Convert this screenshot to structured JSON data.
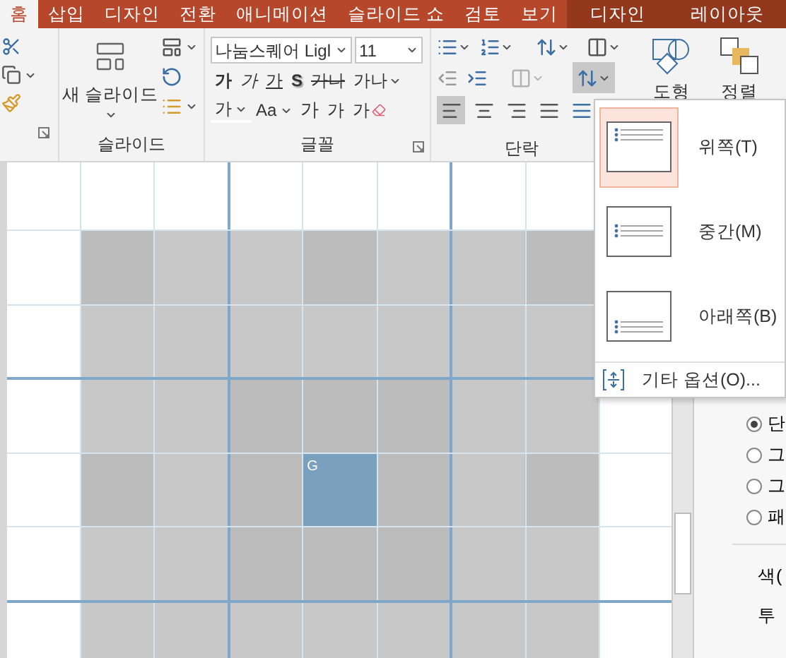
{
  "tabs": [
    {
      "label": "홈",
      "selected": true,
      "contextual": false
    },
    {
      "label": "삽입",
      "selected": false,
      "contextual": false
    },
    {
      "label": "디자인",
      "selected": false,
      "contextual": false
    },
    {
      "label": "전환",
      "selected": false,
      "contextual": false
    },
    {
      "label": "애니메이션",
      "selected": false,
      "contextual": false
    },
    {
      "label": "슬라이드 쇼",
      "selected": false,
      "contextual": false
    },
    {
      "label": "검토",
      "selected": false,
      "contextual": false
    },
    {
      "label": "보기",
      "selected": false,
      "contextual": false
    },
    {
      "label": "디자인",
      "selected": false,
      "contextual": true
    },
    {
      "label": "레이아웃",
      "selected": false,
      "contextual": true
    }
  ],
  "ribbon": {
    "slides_group": {
      "label": "슬라이드",
      "new_slide": "새 슬라이드"
    },
    "font_group": {
      "label": "글꼴",
      "font_name": "나눔스퀘어 Ligl",
      "font_size": "11",
      "row_2": [
        {
          "kind": "bold",
          "text": "가"
        },
        {
          "kind": "italic",
          "text": "가"
        },
        {
          "kind": "underline",
          "text": "가"
        },
        {
          "kind": "shadow",
          "text": "S"
        },
        {
          "kind": "strike",
          "text": "가나"
        },
        {
          "kind": "spacing",
          "text": "가나"
        }
      ],
      "row_3": [
        {
          "kind": "color",
          "text": "가"
        },
        {
          "kind": "case",
          "text": "Aa"
        },
        {
          "kind": "grow",
          "text": "가"
        },
        {
          "kind": "shrink",
          "text": "가"
        },
        {
          "kind": "clear",
          "text": "가"
        }
      ]
    },
    "paragraph_group": {
      "label": "단락",
      "columns_disabled": true,
      "align_text_expanded": true,
      "align_buttons": [
        {
          "kind": "left",
          "selected": true
        },
        {
          "kind": "center",
          "selected": false
        },
        {
          "kind": "right",
          "selected": false
        },
        {
          "kind": "justify",
          "selected": false
        },
        {
          "kind": "distribute",
          "selected": false
        }
      ]
    },
    "drawing_buttons": [
      {
        "kind": "shapes",
        "label": "도형"
      },
      {
        "kind": "arrange",
        "label": "정렬"
      }
    ]
  },
  "menu": {
    "items": [
      {
        "kind": "top",
        "label": "위쪽(T)",
        "selected": true
      },
      {
        "kind": "middle",
        "label": "중간(M)",
        "selected": false
      },
      {
        "kind": "bottom",
        "label": "아래쪽(B)",
        "selected": false
      }
    ],
    "footer": "기타 옵션(O)..."
  },
  "slide": {
    "rows": [
      [
        {
          "kind": "dark"
        },
        {
          "kind": "light"
        },
        {
          "kind": "light"
        },
        {
          "kind": "dark"
        },
        {
          "kind": "light"
        },
        {
          "kind": "light"
        },
        {
          "kind": "dark"
        }
      ],
      [
        {
          "kind": "light"
        },
        {
          "kind": "light"
        },
        {
          "kind": "light"
        },
        {
          "kind": "light"
        },
        {
          "kind": "light"
        },
        {
          "kind": "light"
        },
        {
          "kind": "light"
        }
      ],
      [
        {
          "kind": "light"
        },
        {
          "kind": "light"
        },
        {
          "kind": "dark"
        },
        {
          "kind": "dark"
        },
        {
          "kind": "dark"
        },
        {
          "kind": "light"
        },
        {
          "kind": "light"
        }
      ],
      [
        {
          "kind": "dark"
        },
        {
          "kind": "light"
        },
        {
          "kind": "dark"
        },
        {
          "kind": "highlight",
          "text": "G"
        },
        {
          "kind": "dark"
        },
        {
          "kind": "light"
        },
        {
          "kind": "dark"
        }
      ],
      [
        {
          "kind": "light"
        },
        {
          "kind": "light"
        },
        {
          "kind": "dark"
        },
        {
          "kind": "dark"
        },
        {
          "kind": "dark"
        },
        {
          "kind": "light"
        },
        {
          "kind": "light"
        }
      ],
      [
        {
          "kind": "light"
        },
        {
          "kind": "light"
        },
        {
          "kind": "light"
        },
        {
          "kind": "light"
        },
        {
          "kind": "light"
        },
        {
          "kind": "light"
        },
        {
          "kind": "light"
        }
      ]
    ]
  },
  "format_pane": {
    "fill_options": [
      {
        "label": "단",
        "selected": true
      },
      {
        "label": "그",
        "selected": false
      },
      {
        "label": "그",
        "selected": false
      },
      {
        "label": "패",
        "selected": false
      }
    ],
    "fields": [
      "색(",
      "투"
    ]
  }
}
